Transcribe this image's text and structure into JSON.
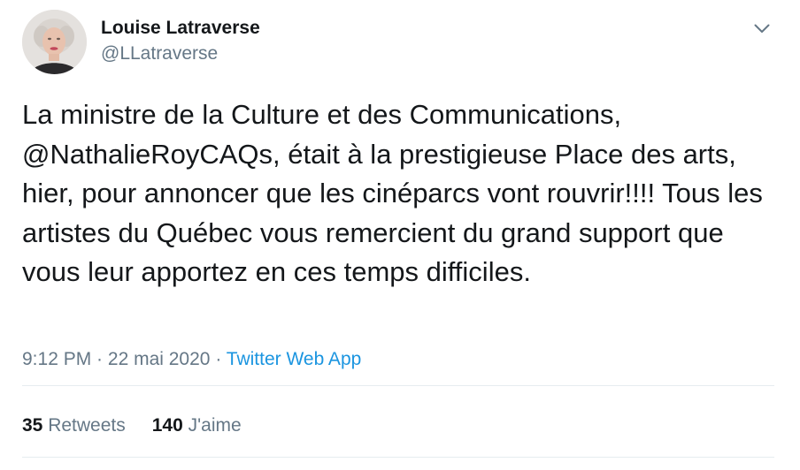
{
  "author": {
    "display_name": "Louise Latraverse",
    "handle": "@LLatraverse"
  },
  "tweet": {
    "text_before": "La ministre de la Culture et des Communications, ",
    "mention": "@NathalieRoyCAQs",
    "text_after": ", était à la prestigieuse Place des arts, hier, pour annoncer que les cinéparcs vont rouvrir!!!! Tous les artistes du Québec vous remercient du grand support que vous leur apportez en ces temps difficiles."
  },
  "meta": {
    "time": "9:12 PM",
    "separator1": " · ",
    "date": "22 mai 2020",
    "separator2": " · ",
    "source": "Twitter Web App"
  },
  "stats": {
    "retweets_count": "35",
    "retweets_label": "Retweets",
    "likes_count": "140",
    "likes_label": "J'aime"
  },
  "icons": {
    "more": "chevron-down-icon"
  },
  "colors": {
    "text": "#14171a",
    "secondary": "#657786",
    "link": "#1b95e0",
    "divider": "#e6ecf0"
  }
}
